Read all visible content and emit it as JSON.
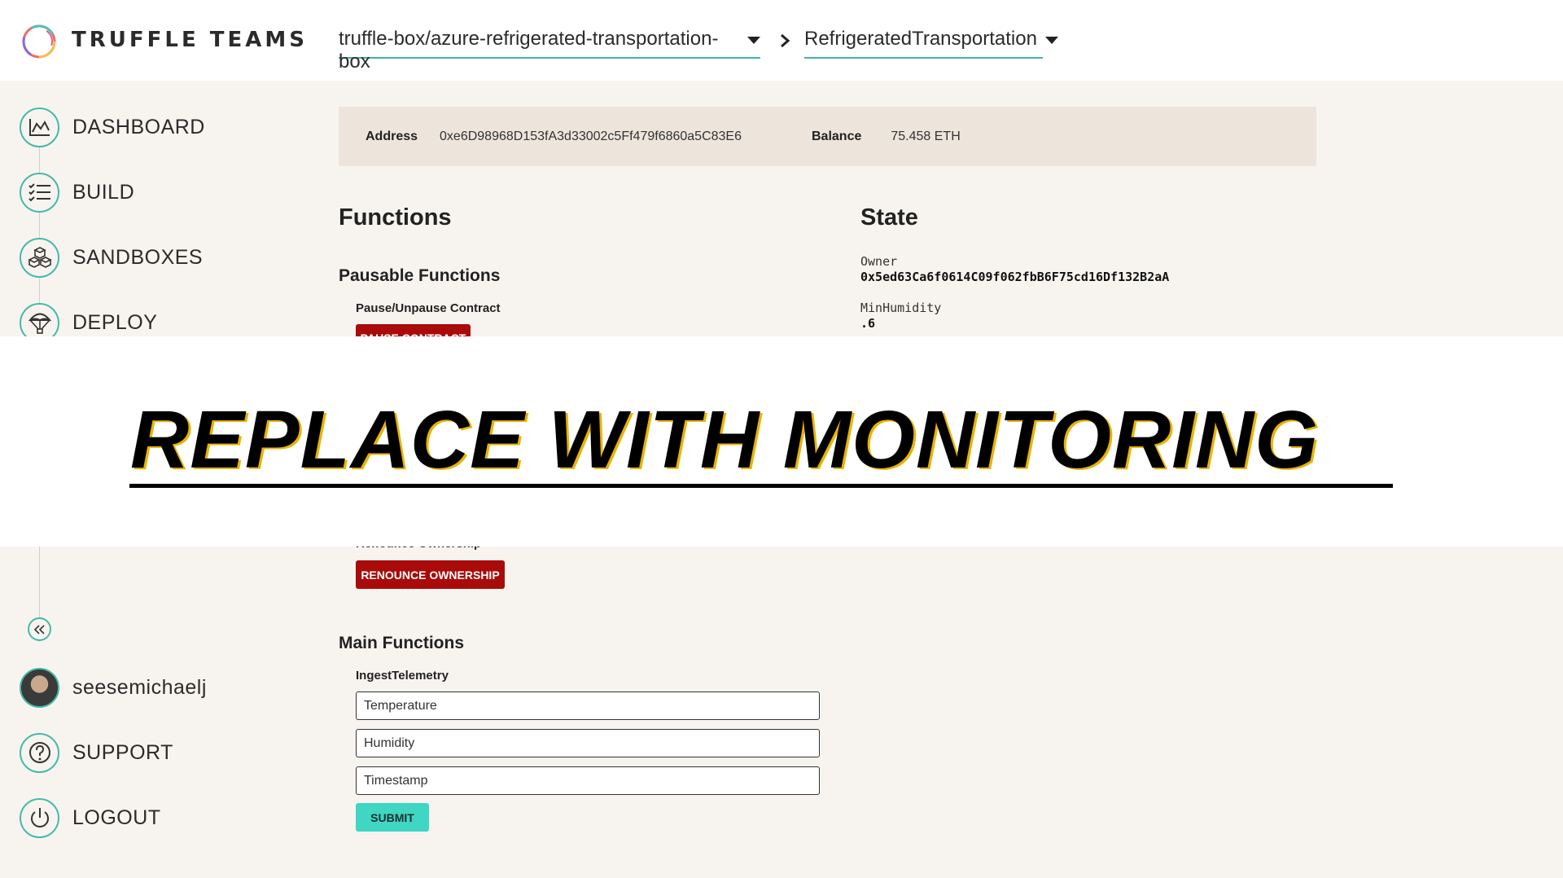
{
  "header": {
    "brand": "TRUFFLE TEAMS",
    "repo": "truffle-box/azure-refrigerated-transportation-box",
    "contract": "RefrigeratedTransportation"
  },
  "sidebar": {
    "items": [
      {
        "label": "DASHBOARD",
        "icon": "chart-icon"
      },
      {
        "label": "BUILD",
        "icon": "checklist-icon"
      },
      {
        "label": "SANDBOXES",
        "icon": "cubes-icon"
      },
      {
        "label": "DEPLOY",
        "icon": "parachute-icon"
      }
    ],
    "username": "seesemichaelj",
    "support": "SUPPORT",
    "logout": "LOGOUT"
  },
  "account": {
    "address_label": "Address",
    "address": "0xe6D98968D153fA3d33002c5Ff479f6860a5C83E6",
    "balance_label": "Balance",
    "balance": "75.458 ETH"
  },
  "functions": {
    "title": "Functions",
    "pausable_title": "Pausable Functions",
    "pause_label": "Pause/Unpause Contract",
    "pause_button": "PAUSE CONTRACT",
    "renounce_label": "Renounce Ownership",
    "renounce_button": "RENOUNCE OWNERSHIP",
    "main_title": "Main Functions",
    "ingest_label": "IngestTelemetry",
    "inputs": {
      "temperature": "Temperature",
      "humidity": "Humidity",
      "timestamp": "Timestamp"
    },
    "submit": "SUBMIT"
  },
  "state": {
    "title": "State",
    "owner_key": "Owner",
    "owner_value": "0x5ed63Ca6f0614C09f062fbB6F75cd16Df132B2aA",
    "minhumidity_key": "MinHumidity",
    "minhumidity_value": ".6"
  },
  "banner": {
    "text": "REPLACE WITH MONITORING"
  },
  "colors": {
    "accent": "#45b9aa",
    "danger": "#a90b0b",
    "submit": "#3fd6c3",
    "address_bar": "#ede4dc"
  }
}
